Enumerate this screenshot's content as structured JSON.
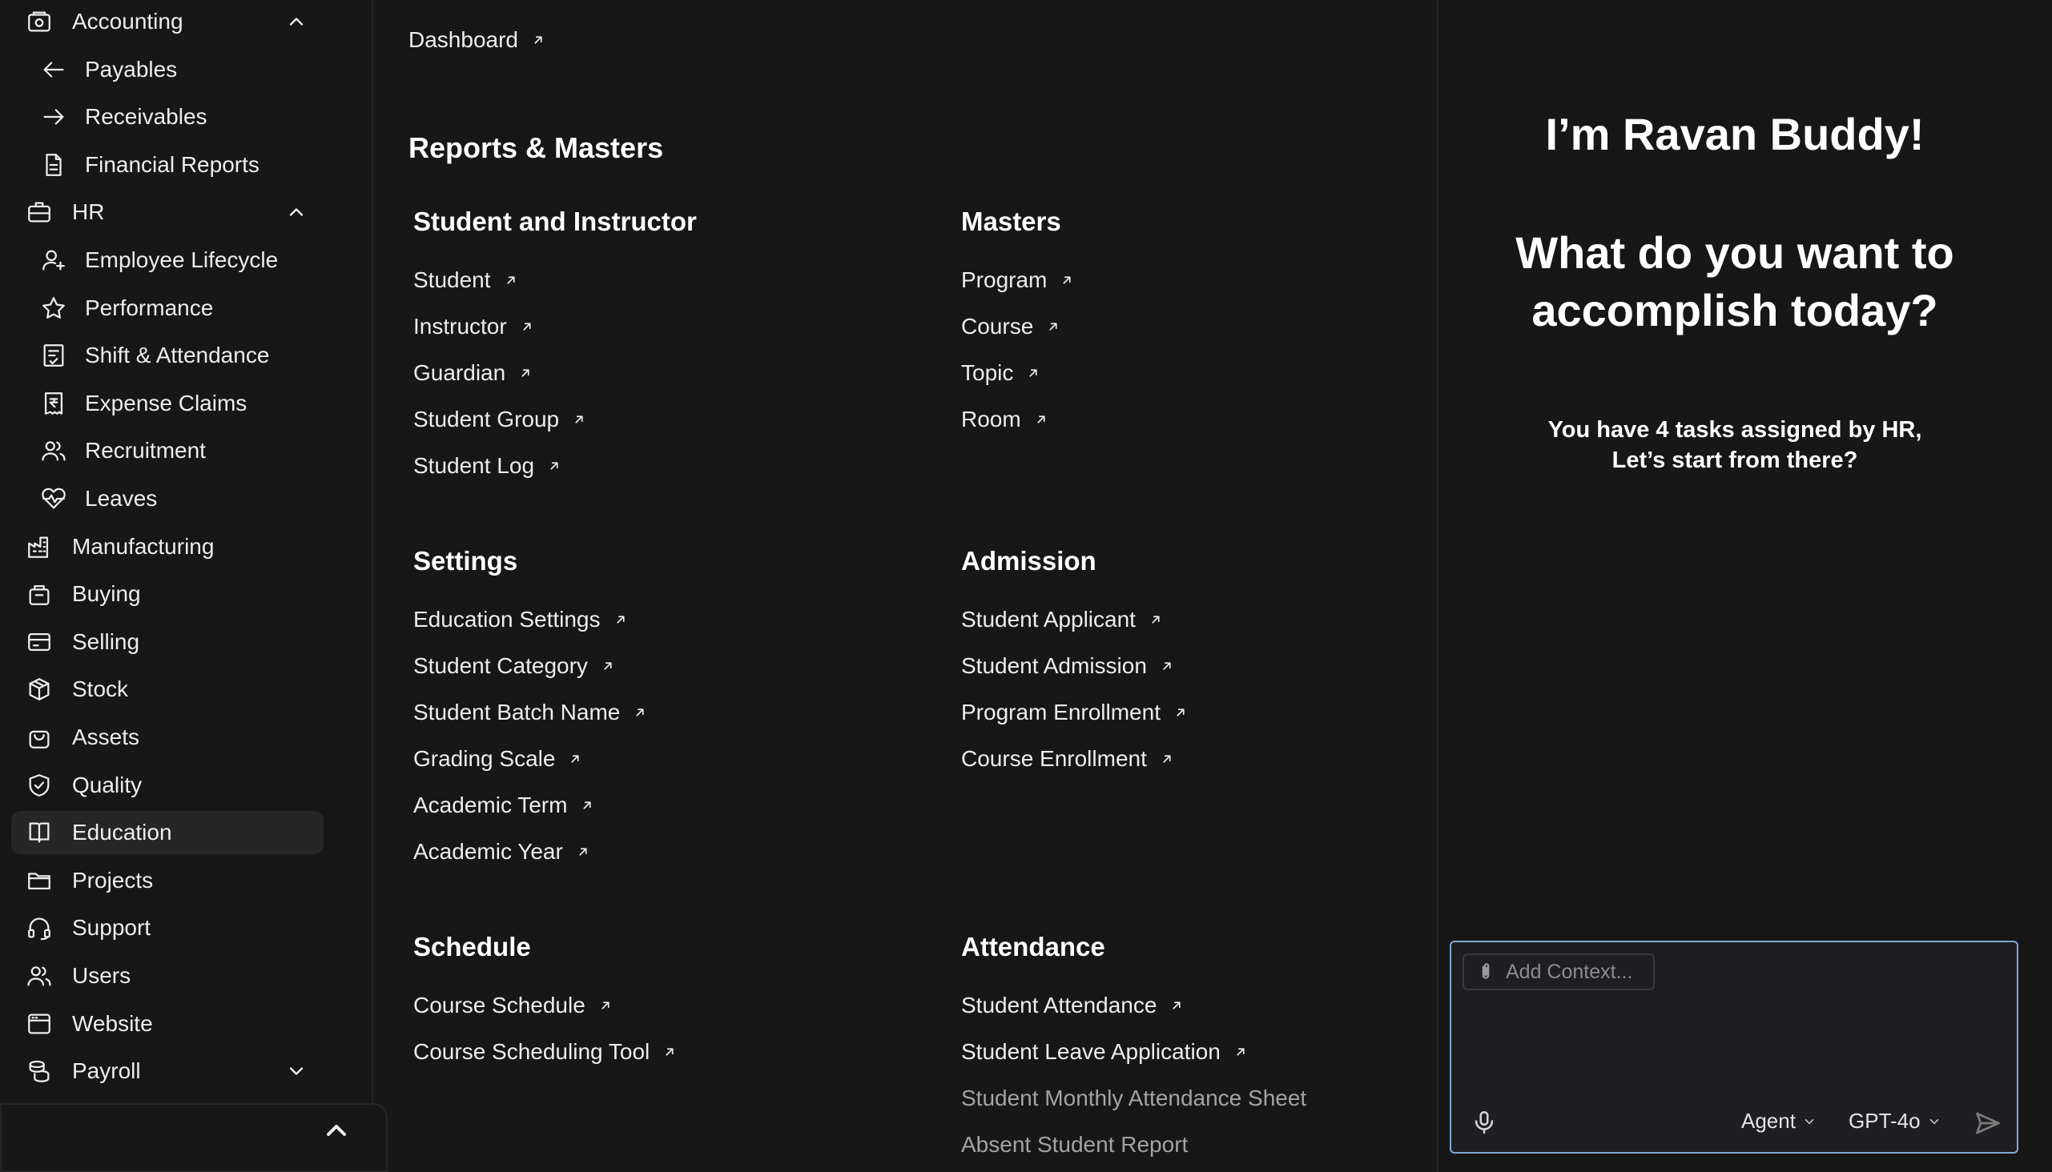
{
  "sidebar": {
    "items": [
      {
        "label": "Accounting",
        "icon": "accounting-icon",
        "level": "top",
        "expanded": true
      },
      {
        "label": "Payables",
        "icon": "arrow-left-icon",
        "level": "sub"
      },
      {
        "label": "Receivables",
        "icon": "arrow-right-icon",
        "level": "sub"
      },
      {
        "label": "Financial Reports",
        "icon": "document-icon",
        "level": "sub"
      },
      {
        "label": "HR",
        "icon": "briefcase-icon",
        "level": "top",
        "expanded": true
      },
      {
        "label": "Employee Lifecycle",
        "icon": "user-plus-icon",
        "level": "sub"
      },
      {
        "label": "Performance",
        "icon": "star-icon",
        "level": "sub"
      },
      {
        "label": "Shift & Attendance",
        "icon": "checklist-icon",
        "level": "sub"
      },
      {
        "label": "Expense Claims",
        "icon": "rupee-receipt-icon",
        "level": "sub"
      },
      {
        "label": "Recruitment",
        "icon": "users-icon",
        "level": "sub"
      },
      {
        "label": "Leaves",
        "icon": "heartbeat-icon",
        "level": "sub"
      },
      {
        "label": "Manufacturing",
        "icon": "factory-icon",
        "level": "top"
      },
      {
        "label": "Buying",
        "icon": "basket-icon",
        "level": "top"
      },
      {
        "label": "Selling",
        "icon": "card-icon",
        "level": "top"
      },
      {
        "label": "Stock",
        "icon": "box-icon",
        "level": "top"
      },
      {
        "label": "Assets",
        "icon": "bag-icon",
        "level": "top"
      },
      {
        "label": "Quality",
        "icon": "shield-check-icon",
        "level": "top"
      },
      {
        "label": "Education",
        "icon": "book-icon",
        "level": "top",
        "active": true
      },
      {
        "label": "Projects",
        "icon": "folder-icon",
        "level": "top"
      },
      {
        "label": "Support",
        "icon": "headset-icon",
        "level": "top"
      },
      {
        "label": "Users",
        "icon": "users-icon",
        "level": "top"
      },
      {
        "label": "Website",
        "icon": "browser-icon",
        "level": "top"
      },
      {
        "label": "Payroll",
        "icon": "coins-icon",
        "level": "top",
        "expanded": false
      }
    ]
  },
  "main": {
    "dashboard_label": "Dashboard",
    "reports_title": "Reports & Masters",
    "sections": [
      {
        "title": "Student and Instructor",
        "links": [
          {
            "label": "Student",
            "arrow": true
          },
          {
            "label": "Instructor",
            "arrow": true
          },
          {
            "label": "Guardian",
            "arrow": true
          },
          {
            "label": "Student Group",
            "arrow": true
          },
          {
            "label": "Student Log",
            "arrow": true
          }
        ]
      },
      {
        "title": "Masters",
        "links": [
          {
            "label": "Program",
            "arrow": true
          },
          {
            "label": "Course",
            "arrow": true
          },
          {
            "label": "Topic",
            "arrow": true
          },
          {
            "label": "Room",
            "arrow": true
          }
        ]
      },
      {
        "title": "Settings",
        "links": [
          {
            "label": "Education Settings",
            "arrow": true
          },
          {
            "label": "Student Category",
            "arrow": true
          },
          {
            "label": "Student Batch Name",
            "arrow": true
          },
          {
            "label": "Grading Scale",
            "arrow": true
          },
          {
            "label": "Academic Term",
            "arrow": true
          },
          {
            "label": "Academic Year",
            "arrow": true
          }
        ]
      },
      {
        "title": "Admission",
        "links": [
          {
            "label": "Student Applicant",
            "arrow": true
          },
          {
            "label": "Student Admission",
            "arrow": true
          },
          {
            "label": "Program Enrollment",
            "arrow": true
          },
          {
            "label": "Course Enrollment",
            "arrow": true
          }
        ]
      },
      {
        "title": "Schedule",
        "links": [
          {
            "label": "Course Schedule",
            "arrow": true
          },
          {
            "label": "Course Scheduling Tool",
            "arrow": true
          }
        ]
      },
      {
        "title": "Attendance",
        "links": [
          {
            "label": "Student Attendance",
            "arrow": true
          },
          {
            "label": "Student Leave Application",
            "arrow": true
          },
          {
            "label": "Student Monthly Attendance Sheet",
            "arrow": false,
            "muted": true
          },
          {
            "label": "Absent Student Report",
            "arrow": false,
            "muted": true
          }
        ]
      }
    ]
  },
  "assistant": {
    "greeting": "I’m Ravan Buddy!",
    "question": "What do you want to accomplish today?",
    "tasks_line1": "You have 4 tasks assigned by HR,",
    "tasks_line2": "Let’s start from there?",
    "context_placeholder": "Add Context...",
    "mode_label": "Agent",
    "model_label": "GPT-4o"
  },
  "colors": {
    "background": "#171717",
    "active_item": "#262626",
    "composer_border": "#7fa8d6",
    "text": "#ededed"
  }
}
